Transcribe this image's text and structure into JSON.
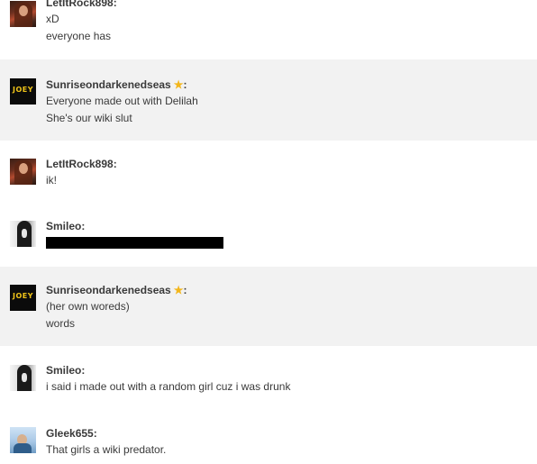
{
  "comments": [
    {
      "user": "LetItRock898:",
      "lines": [
        "xD",
        "everyone has"
      ]
    },
    {
      "user": "Sunriseondarkenedseas",
      "after_star": ":",
      "admin_star": "★",
      "lines": [
        "Everyone made out with Delilah",
        "She's our wiki slut"
      ]
    },
    {
      "user": "LetItRock898:",
      "lines": [
        "ik!"
      ]
    },
    {
      "user": "Smileo:",
      "lines": []
    },
    {
      "user": "Sunriseondarkenedseas",
      "after_star": ":",
      "admin_star": "★",
      "lines": [
        "(her own woreds)",
        "words"
      ]
    },
    {
      "user": "Smileo:",
      "lines": [
        "i said i made out with a random girl cuz i was drunk"
      ]
    },
    {
      "user": "Gleek655:",
      "lines": [
        "That girls a wiki predator."
      ]
    }
  ],
  "avatars": {
    "joey_text": "JOEY"
  },
  "colors": {
    "alt_row": "#f2f2f2",
    "star": "#f3b61b",
    "redaction": "#000000"
  }
}
